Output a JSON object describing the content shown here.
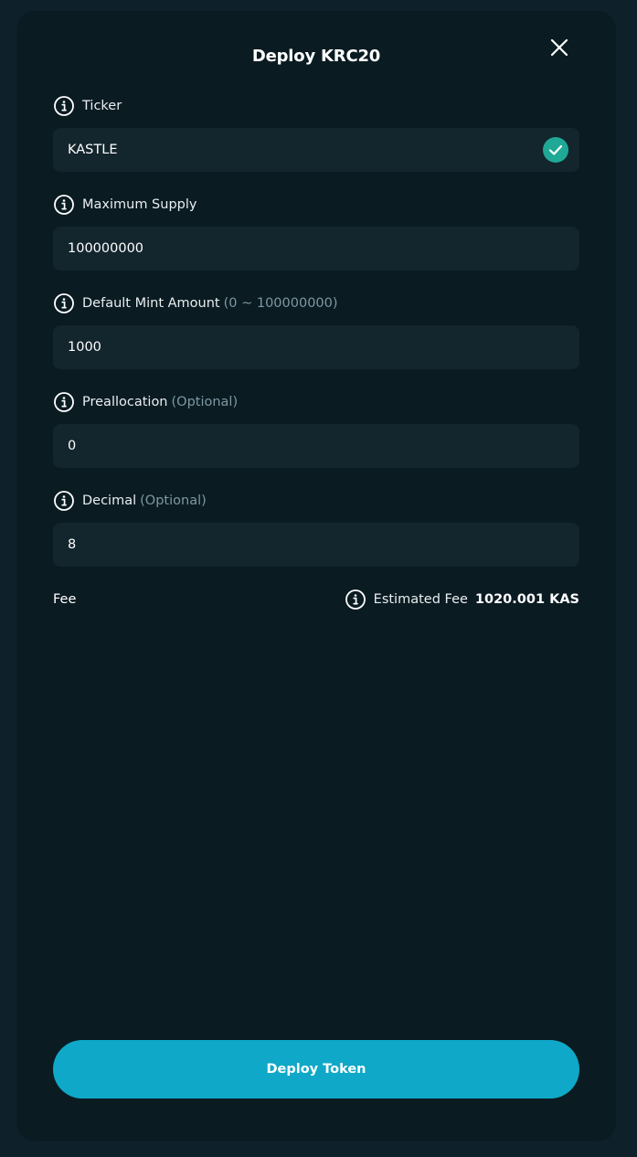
{
  "header": {
    "title": "Deploy KRC20",
    "close_icon": "close-icon"
  },
  "fields": {
    "ticker": {
      "label": "Ticker",
      "value": "KASTLE",
      "valid": true,
      "status_icon": "check-circle-icon"
    },
    "max_supply": {
      "label": "Maximum Supply",
      "value": "100000000"
    },
    "mint_amount": {
      "label": "Default Mint Amount",
      "hint": "(0 ~ 100000000)",
      "value": "1000"
    },
    "preallocation": {
      "label": "Preallocation",
      "hint": "(Optional)",
      "value": "0"
    },
    "decimal": {
      "label": "Decimal",
      "hint": "(Optional)",
      "value": "8"
    }
  },
  "fee": {
    "label": "Fee",
    "estimated_label": "Estimated Fee",
    "estimated_value": "1020.001 KAS"
  },
  "actions": {
    "deploy_label": "Deploy Token"
  },
  "colors": {
    "background": "#0e212b",
    "panel": "#0a1b22",
    "input": "#13252d",
    "accent": "#0fa8c8",
    "success": "#1fa896",
    "hint": "#7d98a3"
  }
}
